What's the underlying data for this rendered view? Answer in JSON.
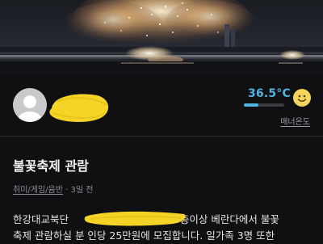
{
  "profile": {
    "temperature": "36.5°C",
    "temperature_level_percent": 36.5,
    "manner_label": "매너온도"
  },
  "post": {
    "title": "불꽃축제 관람",
    "category": "취미/게임/음반",
    "time_ago": "3일 전",
    "body_line1_start": "한강대교북단",
    "body_line1_end": "10층이상 베란다에서 불꽃",
    "body_line2": "축제 관람하실 분 인당 25만원에 모집합니다. 일가족 3명 또한"
  },
  "icons": {
    "avatar": "default-user-avatar",
    "temperature_face": "smile-face-icon"
  },
  "colors": {
    "temperature": "#4fb4e3",
    "redaction": "#f6d426",
    "background": "#101012"
  }
}
